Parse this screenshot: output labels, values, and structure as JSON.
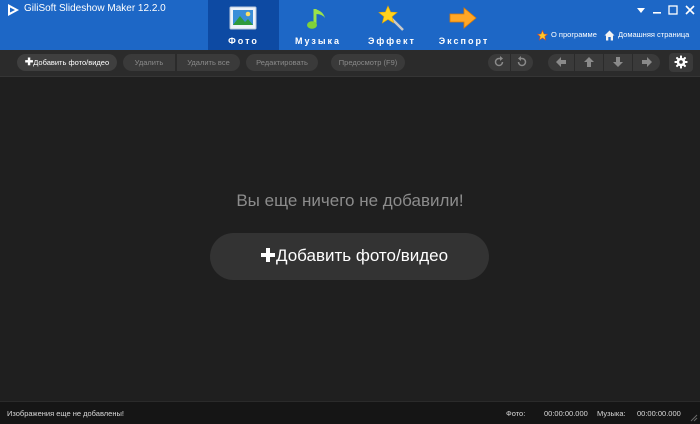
{
  "app": {
    "title": "GiliSoft Slideshow Maker 12.2.0"
  },
  "tabs": [
    {
      "label": "Фото",
      "icon": "photo-icon",
      "active": true
    },
    {
      "label": "Музыка",
      "icon": "music-note-icon",
      "active": false
    },
    {
      "label": "Эффект",
      "icon": "magic-star-icon",
      "active": false
    },
    {
      "label": "Экспорт",
      "icon": "export-arrow-icon",
      "active": false
    }
  ],
  "header_links": {
    "about": "О программе",
    "home": "Домашняя страница"
  },
  "toolbar": {
    "add": "Добавить фото/видео",
    "delete": "Удалить",
    "delete_all": "Удалить все",
    "edit": "Редактировать",
    "preview": "Предосмотр (F9)"
  },
  "main": {
    "empty_message": "Вы еще ничего не добавили!",
    "add_button": "Добавить фото/видео"
  },
  "status": {
    "message": "Изображения еще не добавлены!",
    "photo_label": "Фото:",
    "photo_time": "00:00:00.000",
    "music_label": "Музыка:",
    "music_time": "00:00:00.000"
  },
  "colors": {
    "header": "#1d67c6",
    "active_tab": "#0d4aa3",
    "background": "#1f1f1f"
  }
}
